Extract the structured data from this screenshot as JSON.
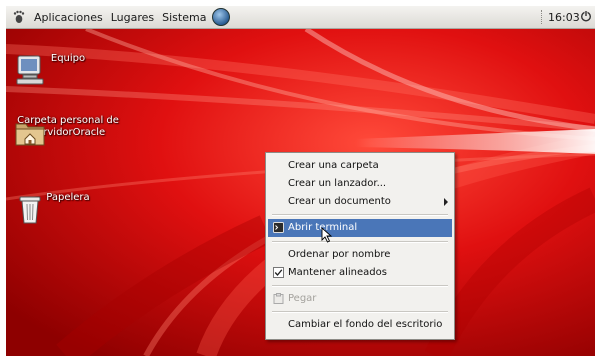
{
  "panel": {
    "menus": [
      "Aplicaciones",
      "Lugares",
      "Sistema"
    ],
    "clock": "16:03"
  },
  "desktop": {
    "icons": [
      {
        "label": "Equipo",
        "icon": "computer-icon"
      },
      {
        "label": "Carpeta personal de ServidorOracle",
        "icon": "home-folder-icon"
      },
      {
        "label": "Papelera",
        "icon": "trash-icon"
      }
    ]
  },
  "context_menu": {
    "items": [
      {
        "label": "Crear una carpeta",
        "state": "normal"
      },
      {
        "label": "Crear un lanzador...",
        "state": "normal"
      },
      {
        "label": "Crear un documento",
        "state": "submenu"
      },
      {
        "label": "Abrir terminal",
        "state": "highlighted",
        "icon": "terminal-icon"
      },
      {
        "label": "Ordenar por nombre",
        "state": "normal"
      },
      {
        "label": "Mantener alineados",
        "state": "checked"
      },
      {
        "label": "Pegar",
        "state": "disabled",
        "icon": "paste-icon"
      },
      {
        "label": "Cambiar el fondo del escritorio",
        "state": "normal"
      }
    ]
  },
  "colors": {
    "wallpaper": "#c80000",
    "menu_highlight": "#4a76b8",
    "panel": "#e8e6e1"
  }
}
